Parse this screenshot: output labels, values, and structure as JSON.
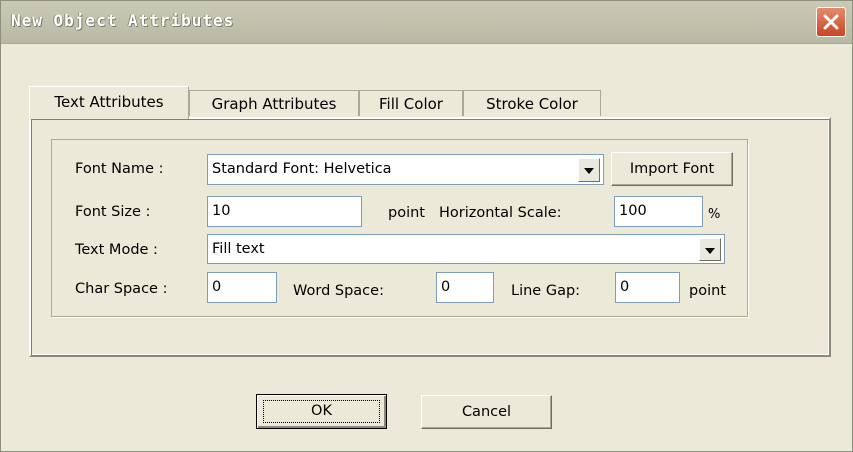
{
  "window": {
    "title": "New Object Attributes"
  },
  "tabs": [
    {
      "label": "Text Attributes",
      "active": true
    },
    {
      "label": "Graph Attributes",
      "active": false
    },
    {
      "label": "Fill Color",
      "active": false
    },
    {
      "label": "Stroke Color",
      "active": false
    }
  ],
  "form": {
    "font_name": {
      "label": "Font Name :",
      "value": "Standard Font: Helvetica"
    },
    "import_font_button": "Import Font",
    "font_size": {
      "label": "Font Size :",
      "value": "10",
      "unit": "point"
    },
    "horizontal_scale": {
      "label": "Horizontal Scale:",
      "value": "100",
      "unit": "%"
    },
    "text_mode": {
      "label": "Text Mode :",
      "value": "Fill text"
    },
    "char_space": {
      "label": "Char Space :",
      "value": "0"
    },
    "word_space": {
      "label": "Word Space:",
      "value": "0"
    },
    "line_gap": {
      "label": "Line Gap:",
      "value": "0",
      "unit": "point"
    }
  },
  "buttons": {
    "ok": "OK",
    "cancel": "Cancel"
  },
  "icons": {
    "close": "close-icon",
    "dropdown": "dropdown-arrow-icon"
  }
}
